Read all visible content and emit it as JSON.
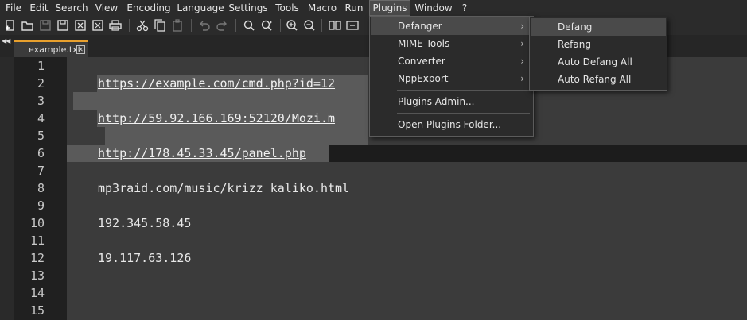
{
  "menubar": {
    "items": [
      "File",
      "Edit",
      "Search",
      "View",
      "Encoding",
      "Language",
      "Settings",
      "Tools",
      "Macro",
      "Run",
      "Plugins",
      "Window",
      "?"
    ],
    "active": "Plugins"
  },
  "toolbar": {
    "icons": [
      "new-file-icon",
      "open-folder-icon",
      "save-icon",
      "save-all-icon",
      "close-icon",
      "close-all-icon",
      "print-icon",
      "cut-icon",
      "copy-icon",
      "paste-icon",
      "undo-icon",
      "redo-icon",
      "find-icon",
      "replace-icon",
      "zoom-in-icon",
      "zoom-out-icon",
      "sync-scroll-icon",
      "word-wrap-icon"
    ]
  },
  "tabs": [
    {
      "label": "example.txt",
      "active": true
    }
  ],
  "editor": {
    "line_numbers": [
      "1",
      "2",
      "3",
      "4",
      "5",
      "6",
      "7",
      "8",
      "9",
      "10",
      "11",
      "12",
      "13",
      "14",
      "15"
    ],
    "lines": [
      "",
      "https://example.com/cmd.php?id=12",
      "",
      "http://59.92.166.169:52120/Mozi.m",
      "",
      "http://178.45.33.45/panel.php",
      "",
      "mp3raid.com/music/krizz_kaliko.html",
      "",
      "192.345.58.45",
      "",
      "19.117.63.126",
      "",
      "",
      ""
    ]
  },
  "plugins_menu": {
    "items": [
      {
        "label": "Defanger",
        "submenu": true
      },
      {
        "label": "MIME Tools",
        "submenu": true
      },
      {
        "label": "Converter",
        "submenu": true
      },
      {
        "label": "NppExport",
        "submenu": true
      },
      {
        "label": "Plugins Admin...",
        "submenu": false
      },
      {
        "label": "Open Plugins Folder...",
        "submenu": false
      }
    ],
    "submenu_arrow": "›"
  },
  "defanger_submenu": {
    "items": [
      "Defang",
      "Refang",
      "Auto Defang All",
      "Auto Refang All"
    ]
  },
  "colors": {
    "menubar_bg": "#2b2b2b",
    "editor_bg": "#3b3b3b",
    "gutter_bg": "#202020",
    "selection": "#5a5a5a",
    "tab_accent": "#e8a02d"
  }
}
